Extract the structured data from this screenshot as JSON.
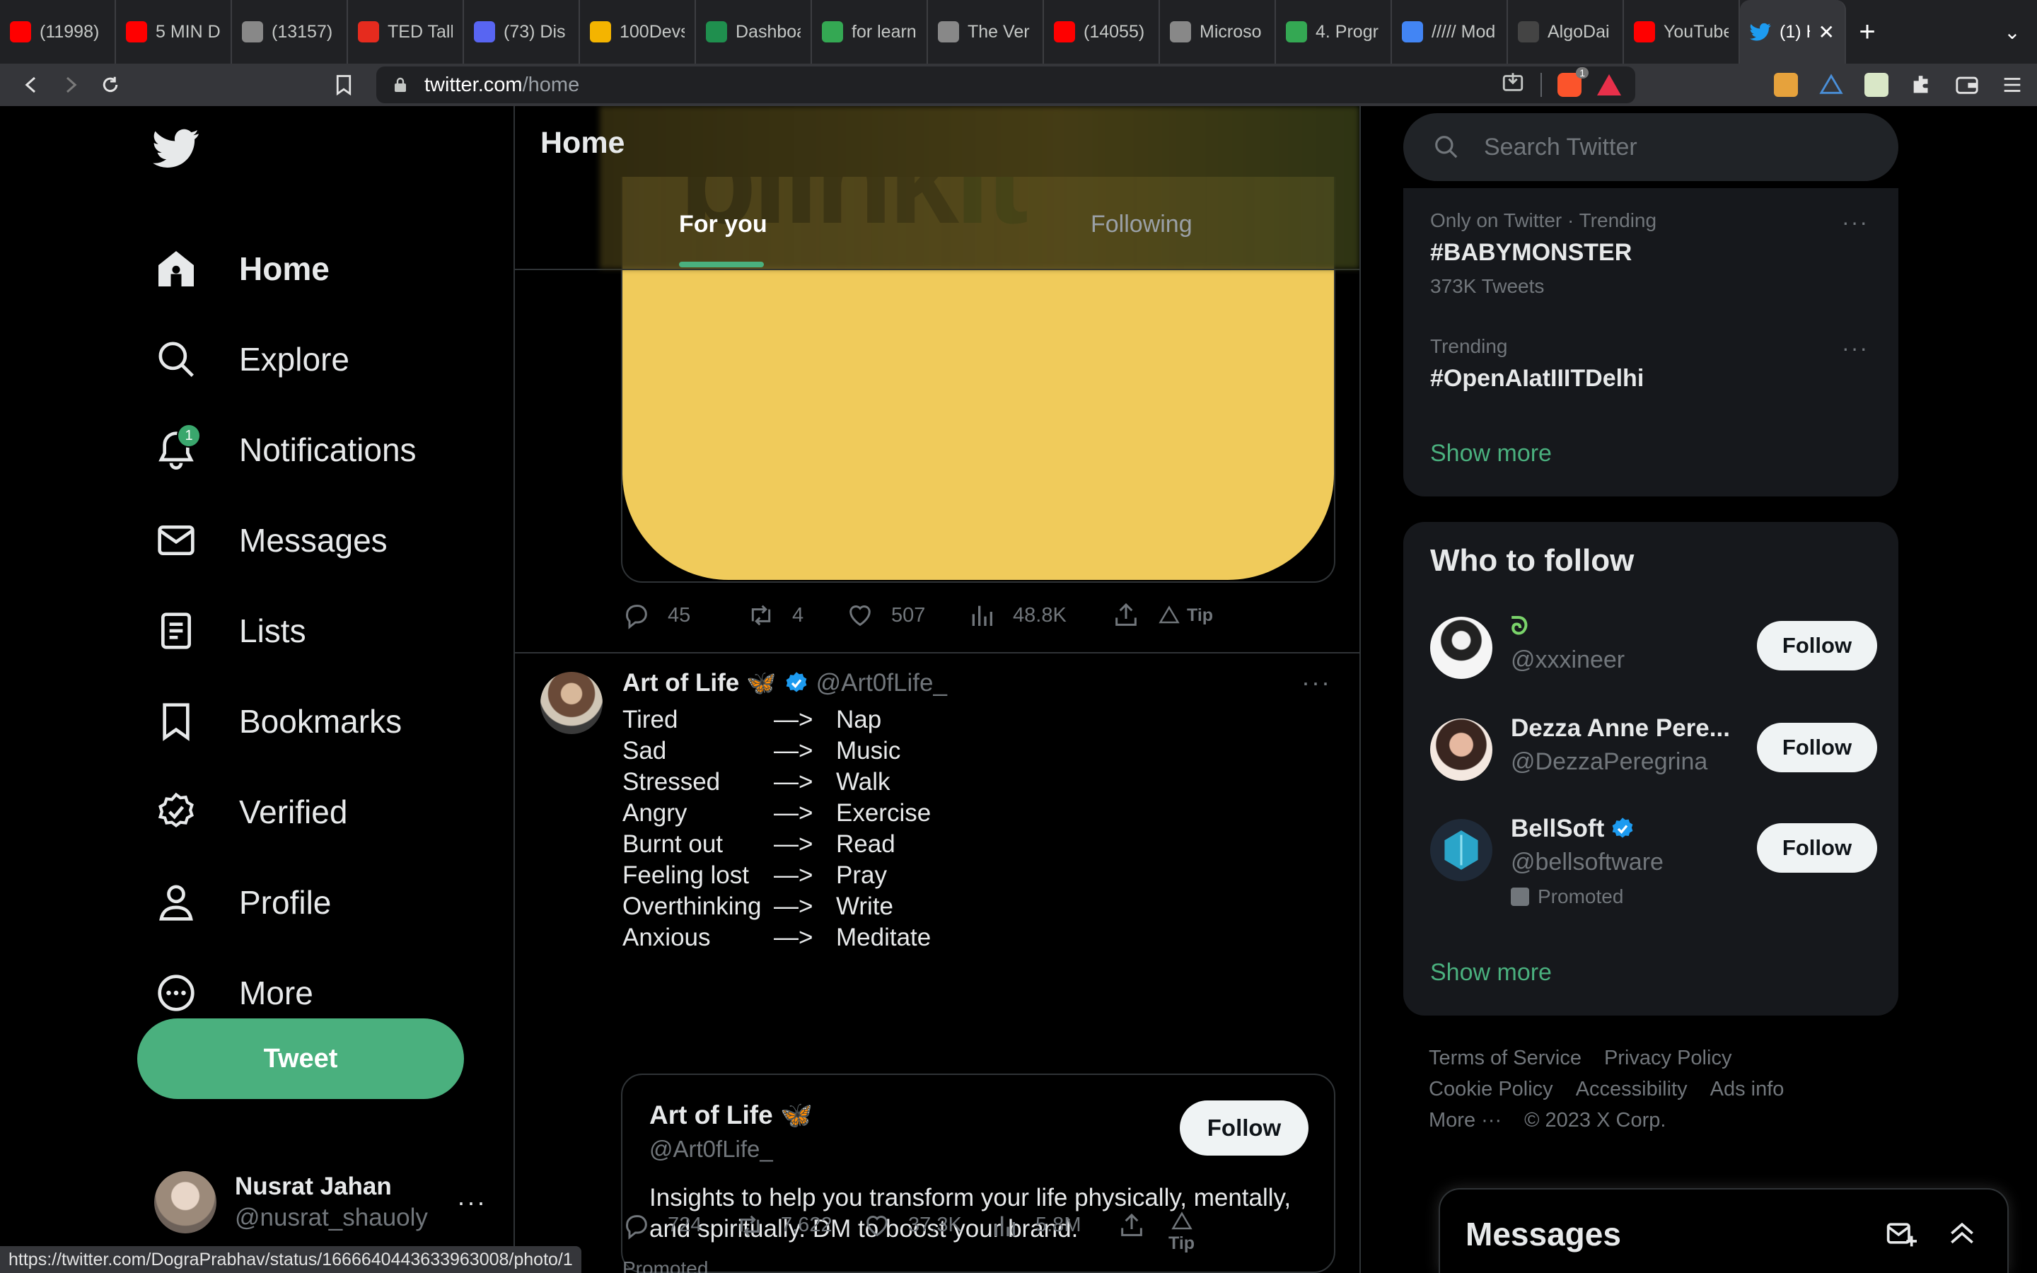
{
  "browser": {
    "tabs": [
      {
        "label": "(11998)",
        "icon": "youtube-icon",
        "color": "#ff0000"
      },
      {
        "label": "5 MIN D",
        "icon": "youtube-icon",
        "color": "#ff0000"
      },
      {
        "label": "(13157)",
        "icon": "globe-icon",
        "color": "#888888"
      },
      {
        "label": "TED Talk",
        "icon": "ted-icon",
        "color": "#e62b1e"
      },
      {
        "label": "(73) Dis",
        "icon": "discord-icon",
        "color": "#5865f2"
      },
      {
        "label": "100Devs",
        "icon": "emoji-icon",
        "color": "#f4b400"
      },
      {
        "label": "Dashboa",
        "icon": "dashboard-icon",
        "color": "#1f8f4e"
      },
      {
        "label": "for learn",
        "icon": "drive-icon",
        "color": "#34a853"
      },
      {
        "label": "The Ver",
        "icon": "globe-icon",
        "color": "#888888"
      },
      {
        "label": "(14055)",
        "icon": "youtube-icon",
        "color": "#ff0000"
      },
      {
        "label": "Microso",
        "icon": "globe-icon",
        "color": "#888888"
      },
      {
        "label": "4. Progr",
        "icon": "drive-icon",
        "color": "#34a853"
      },
      {
        "label": "///// Mod",
        "icon": "docs-icon",
        "color": "#4285f4"
      },
      {
        "label": "AlgoDai",
        "icon": "algodaily-icon",
        "color": "#444444"
      },
      {
        "label": "YouTube",
        "icon": "youtube-icon",
        "color": "#ff0000"
      }
    ],
    "active_tab": {
      "label": "(1) H",
      "icon": "twitter-icon",
      "close": "✕"
    },
    "new_tab": "+",
    "tab_menu": "⌄",
    "url_host": "twitter.com",
    "url_path": "/home",
    "brave_badge": "1",
    "status_url": "https://twitter.com/DograPrabhav/status/1666640443633963008/photo/1"
  },
  "sidebar": {
    "nav": [
      {
        "label": "Home",
        "icon": "home-icon",
        "active": true
      },
      {
        "label": "Explore",
        "icon": "search-icon"
      },
      {
        "label": "Notifications",
        "icon": "bell-icon",
        "badge": "1"
      },
      {
        "label": "Messages",
        "icon": "mail-icon"
      },
      {
        "label": "Lists",
        "icon": "list-icon"
      },
      {
        "label": "Bookmarks",
        "icon": "bookmark-icon"
      },
      {
        "label": "Verified",
        "icon": "verified-icon"
      },
      {
        "label": "Profile",
        "icon": "profile-icon"
      },
      {
        "label": "More",
        "icon": "more-circle-icon"
      }
    ],
    "tweet_label": "Tweet",
    "account": {
      "name": "Nusrat Jahan",
      "handle": "@nusrat_shauoly",
      "more": "···"
    }
  },
  "feed": {
    "title": "Home",
    "tabs": [
      "For you",
      "Following"
    ],
    "media_text_1": "blink",
    "media_text_2": "it",
    "first_tweet_actions": {
      "replies": "45",
      "retweets": "4",
      "likes": "507",
      "views": "48.8K",
      "tip": "Tip"
    },
    "post": {
      "name": "Art of Life",
      "handle": "@Art0fLife_",
      "lines": [
        {
          "a": "Tired",
          "arrow": "—>",
          "b": "Nap"
        },
        {
          "a": "Sad",
          "arrow": "—>",
          "b": "Music"
        },
        {
          "a": "Stressed",
          "arrow": "—>",
          "b": "Walk"
        },
        {
          "a": "Angry",
          "arrow": "—>",
          "b": "Exercise"
        },
        {
          "a": "Burnt out",
          "arrow": "—>",
          "b": "Read"
        },
        {
          "a": "Feeling lost",
          "arrow": "—>",
          "b": "Pray"
        },
        {
          "a": "Overthinking",
          "arrow": "—>",
          "b": "Write"
        },
        {
          "a": "Anxious",
          "arrow": "—>",
          "b": "Meditate"
        }
      ],
      "card": {
        "name": "Art of Life",
        "handle": "@Art0fLife_",
        "follow": "Follow",
        "bio": "Insights to help you transform your life physically, mentally, and spiritually. DM to boost your brand."
      },
      "actions": {
        "replies": "724",
        "retweets": "7,622",
        "likes": "37.3K",
        "views": "5.8M",
        "tip": "Tip"
      },
      "promoted": "Promoted"
    }
  },
  "right": {
    "search_placeholder": "Search Twitter",
    "trends": [
      {
        "meta": "Only on Twitter · Trending",
        "name": "#BABYMONSTER",
        "count": "373K Tweets"
      },
      {
        "meta": "Trending",
        "name": "#OpenAIatIIITDelhi",
        "count": ""
      }
    ],
    "show_more": "Show more",
    "who_to_follow": {
      "title": "Who to follow",
      "accounts": [
        {
          "name": "ᘐ",
          "handle": "@xxxineer",
          "follow": "Follow"
        },
        {
          "name": "Dezza Anne Pere...",
          "handle": "@DezzaPeregrina",
          "follow": "Follow"
        },
        {
          "name": "BellSoft",
          "handle": "@bellsoftware",
          "follow": "Follow",
          "promoted": "Promoted"
        }
      ],
      "show_more": "Show more"
    },
    "footer": [
      "Terms of Service",
      "Privacy Policy",
      "Cookie Policy",
      "Accessibility",
      "Ads info",
      "More ···",
      "© 2023 X Corp."
    ],
    "messages_title": "Messages"
  },
  "colors": {
    "accent": "#4ab07e",
    "blinkit_yellow": "#f0cb5b",
    "blinkit_green": "#3b8b2e",
    "verified": "#1d9bf0"
  }
}
